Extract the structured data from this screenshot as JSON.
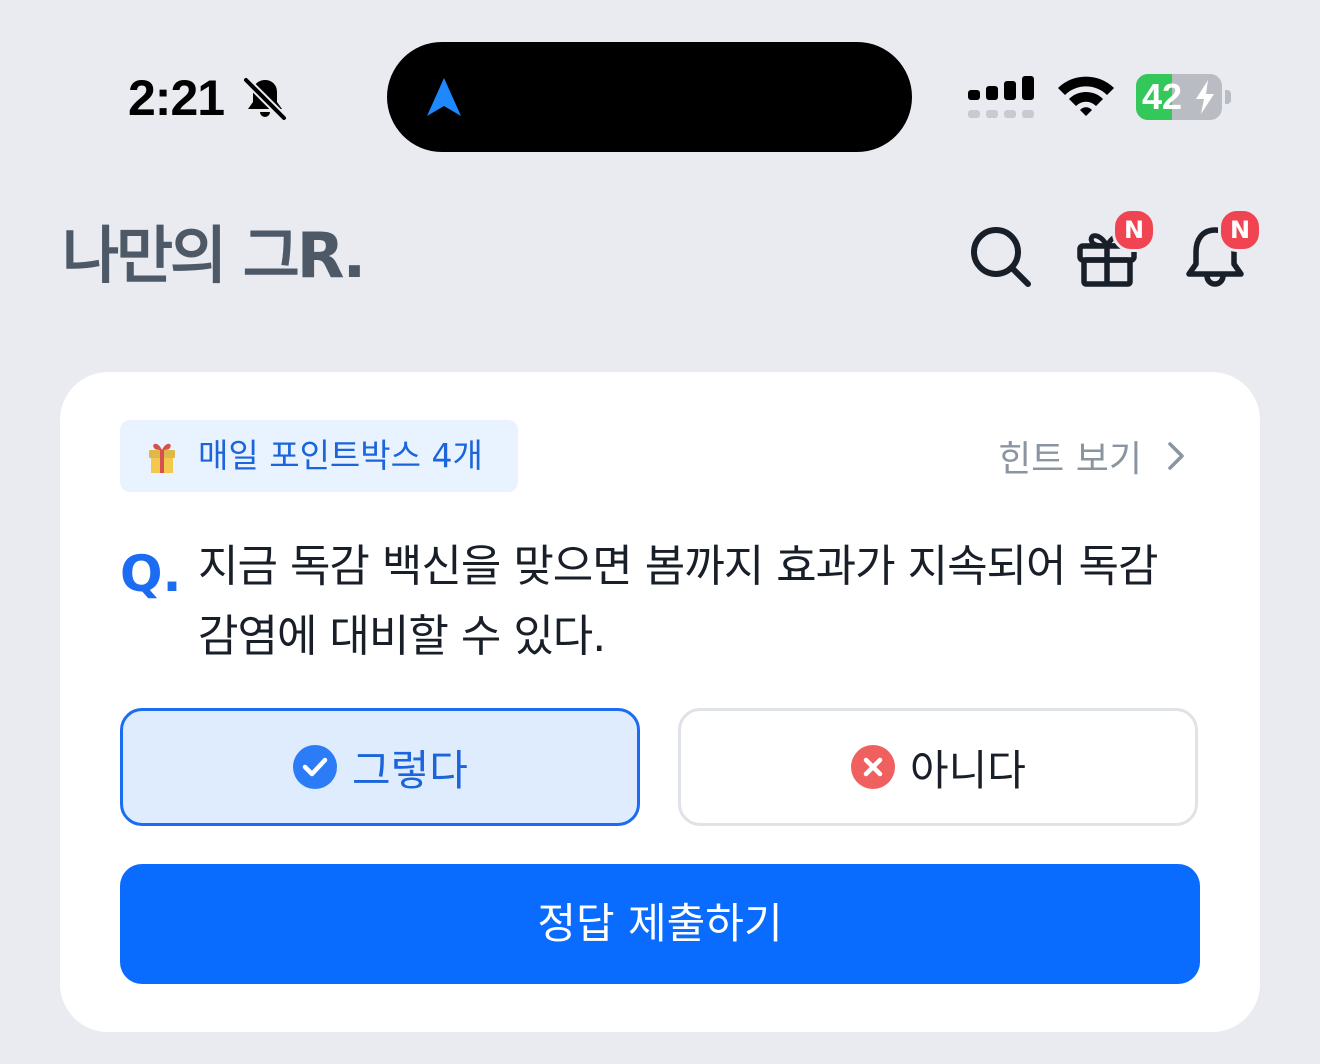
{
  "status_bar": {
    "time": "2:21",
    "battery_level": "42",
    "battery_percent": 42,
    "icons": [
      "bell-slash-icon",
      "navigation-arrow-icon",
      "cellular-signal-icon",
      "wifi-icon",
      "battery-charging-icon"
    ]
  },
  "header": {
    "logo": "나만의 그R.",
    "logo_color": "#4e5968",
    "gift_badge": "N",
    "notification_badge": "N",
    "badge_color": "#f04452"
  },
  "quiz": {
    "points_chip": "매일 포인트박스 4개",
    "points_icon": "🎁",
    "hint_label": "힌트 보기",
    "q_mark": "Q.",
    "question": "지금 독감 백신을 맞으면 봄까지 효과가 지속되어 독감 감염에 대비할 수 있다.",
    "option_yes": "그렇다",
    "option_no": "아니다",
    "selected_option": "그렇다",
    "submit_label": "정답 제출하기",
    "accent_color": "#0a6cff"
  }
}
